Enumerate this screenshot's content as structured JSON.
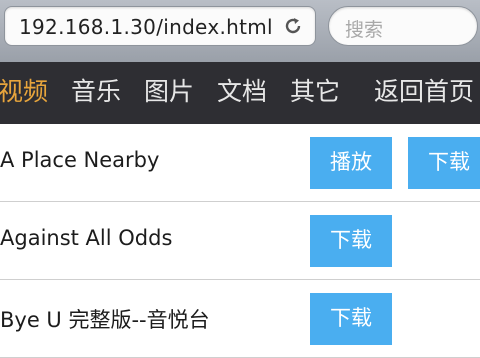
{
  "browser": {
    "url": "192.168.1.30/index.html",
    "search_placeholder": "搜索"
  },
  "nav": {
    "items": [
      {
        "label": "视频",
        "active": true
      },
      {
        "label": "音乐",
        "active": false
      },
      {
        "label": "图片",
        "active": false
      },
      {
        "label": "文档",
        "active": false
      },
      {
        "label": "其它",
        "active": false
      },
      {
        "label": "返回首页",
        "active": false
      }
    ]
  },
  "list": {
    "items": [
      {
        "title": "A Place Nearby",
        "play_label": "播放",
        "download_label": "下载"
      },
      {
        "title": "Against All Odds",
        "download_label": "下载"
      },
      {
        "title": "Bye U 完整版--音悦台",
        "download_label": "下载"
      }
    ]
  },
  "colors": {
    "accent": "#e8a53c",
    "nav_bg": "#2e2e33",
    "button_bg": "#4aaef0"
  }
}
